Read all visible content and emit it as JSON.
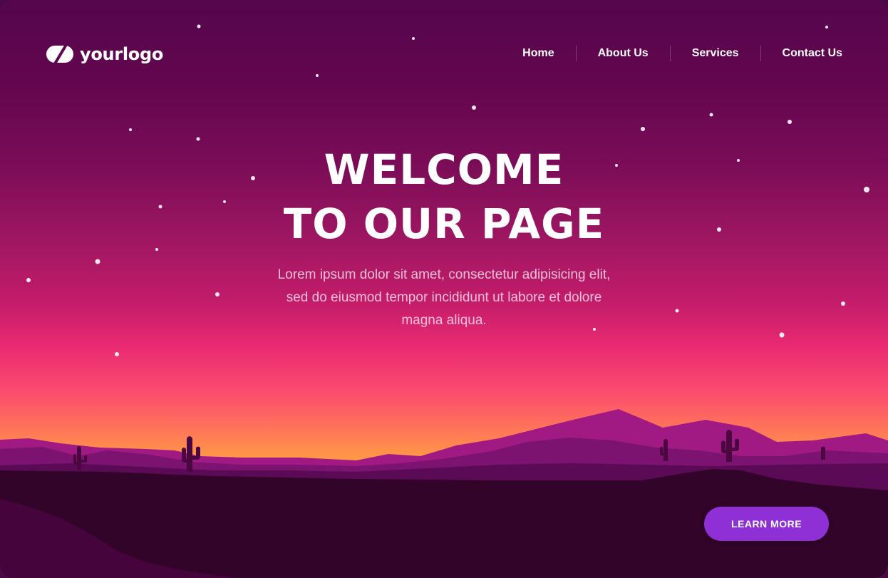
{
  "header": {
    "logo_text": "yourlogo",
    "logo_icon": "leaf-slash-icon"
  },
  "nav": {
    "items": [
      {
        "label": "Home"
      },
      {
        "label": "About Us"
      },
      {
        "label": "Services"
      },
      {
        "label": "Contact Us"
      }
    ]
  },
  "hero": {
    "title_line1": "WELCOME",
    "title_line2": "TO OUR PAGE",
    "body_line1": "Lorem ipsum dolor sit amet, consectetur adipisicing elit,",
    "body_line2": "sed do eiusmod tempor incididunt ut labore et dolore",
    "body_line3": "magna aliqua."
  },
  "cta": {
    "label": "LEARN MORE"
  },
  "colors": {
    "sky_top": "#55064d",
    "sky_mid": "#ea2a72",
    "sky_horizon": "#ff9746",
    "mountains": "#8e1a78",
    "ground": "#2f0428",
    "button": "#8f30d6",
    "text": "#ffffff"
  }
}
